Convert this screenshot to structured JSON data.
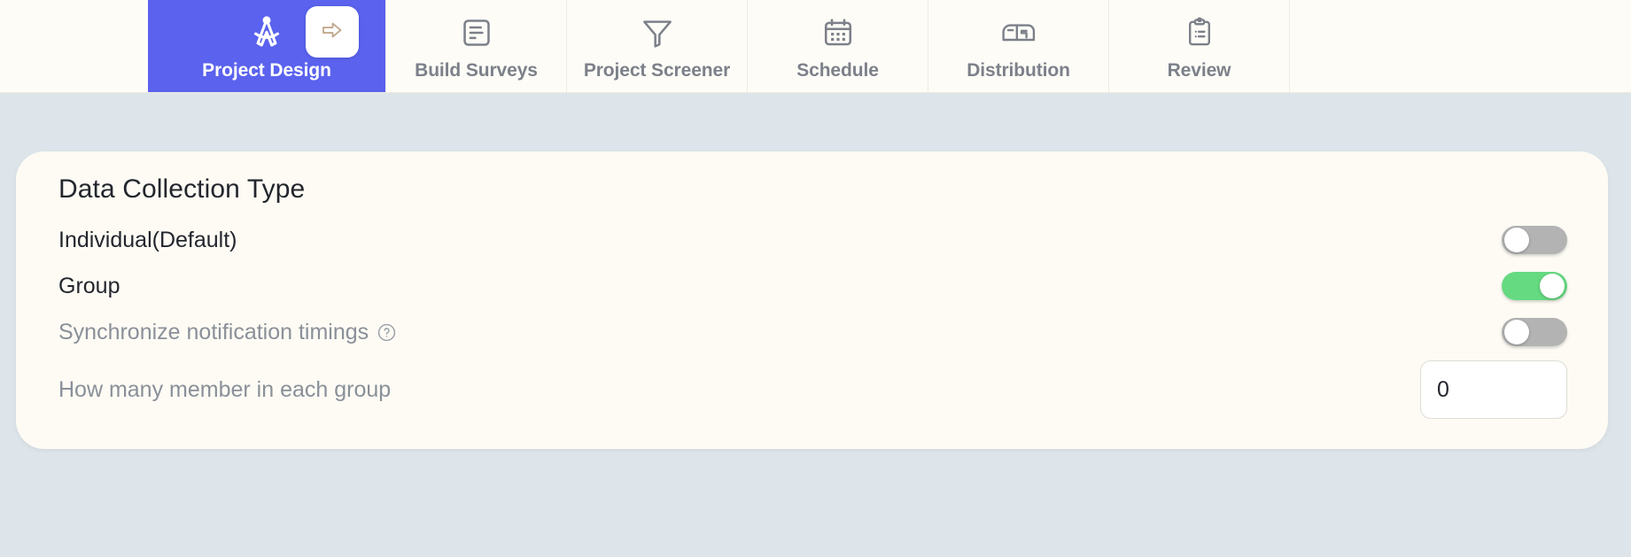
{
  "theme": {
    "active_tab_bg": "#5a62ee",
    "tabbar_bg": "#fdfcf7",
    "page_bg": "#dde5ea",
    "card_bg": "#fdfbf4",
    "toggle_on": "#66da81",
    "toggle_off": "#b3b3b3",
    "muted_text": "#8a9099",
    "icon_gray": "#7c8089"
  },
  "tabbar": {
    "next_button": {
      "icon": "arrow-right-icon",
      "label": ""
    },
    "tabs": [
      {
        "label": "Project Design",
        "icon": "compass-icon",
        "active": true
      },
      {
        "label": "Build Surveys",
        "icon": "document-lines-icon",
        "active": false
      },
      {
        "label": "Project Screener",
        "icon": "funnel-icon",
        "active": false
      },
      {
        "label": "Schedule",
        "icon": "calendar-icon",
        "active": false
      },
      {
        "label": "Distribution",
        "icon": "mailbox-icon",
        "active": false
      },
      {
        "label": "Review",
        "icon": "clipboard-icon",
        "active": false
      }
    ]
  },
  "card": {
    "title": "Data Collection Type",
    "rows": [
      {
        "label": "Individual(Default)",
        "muted": false,
        "control": "toggle",
        "state": "off",
        "help": false
      },
      {
        "label": "Group",
        "muted": false,
        "control": "toggle",
        "state": "on",
        "help": false
      },
      {
        "label": "Synchronize notification timings",
        "muted": true,
        "control": "toggle",
        "state": "off",
        "help": true,
        "help_icon": "question-circle-icon"
      },
      {
        "label": "How many member in each group",
        "muted": true,
        "control": "number",
        "value": "0",
        "placeholder": "0",
        "help": false
      }
    ]
  }
}
